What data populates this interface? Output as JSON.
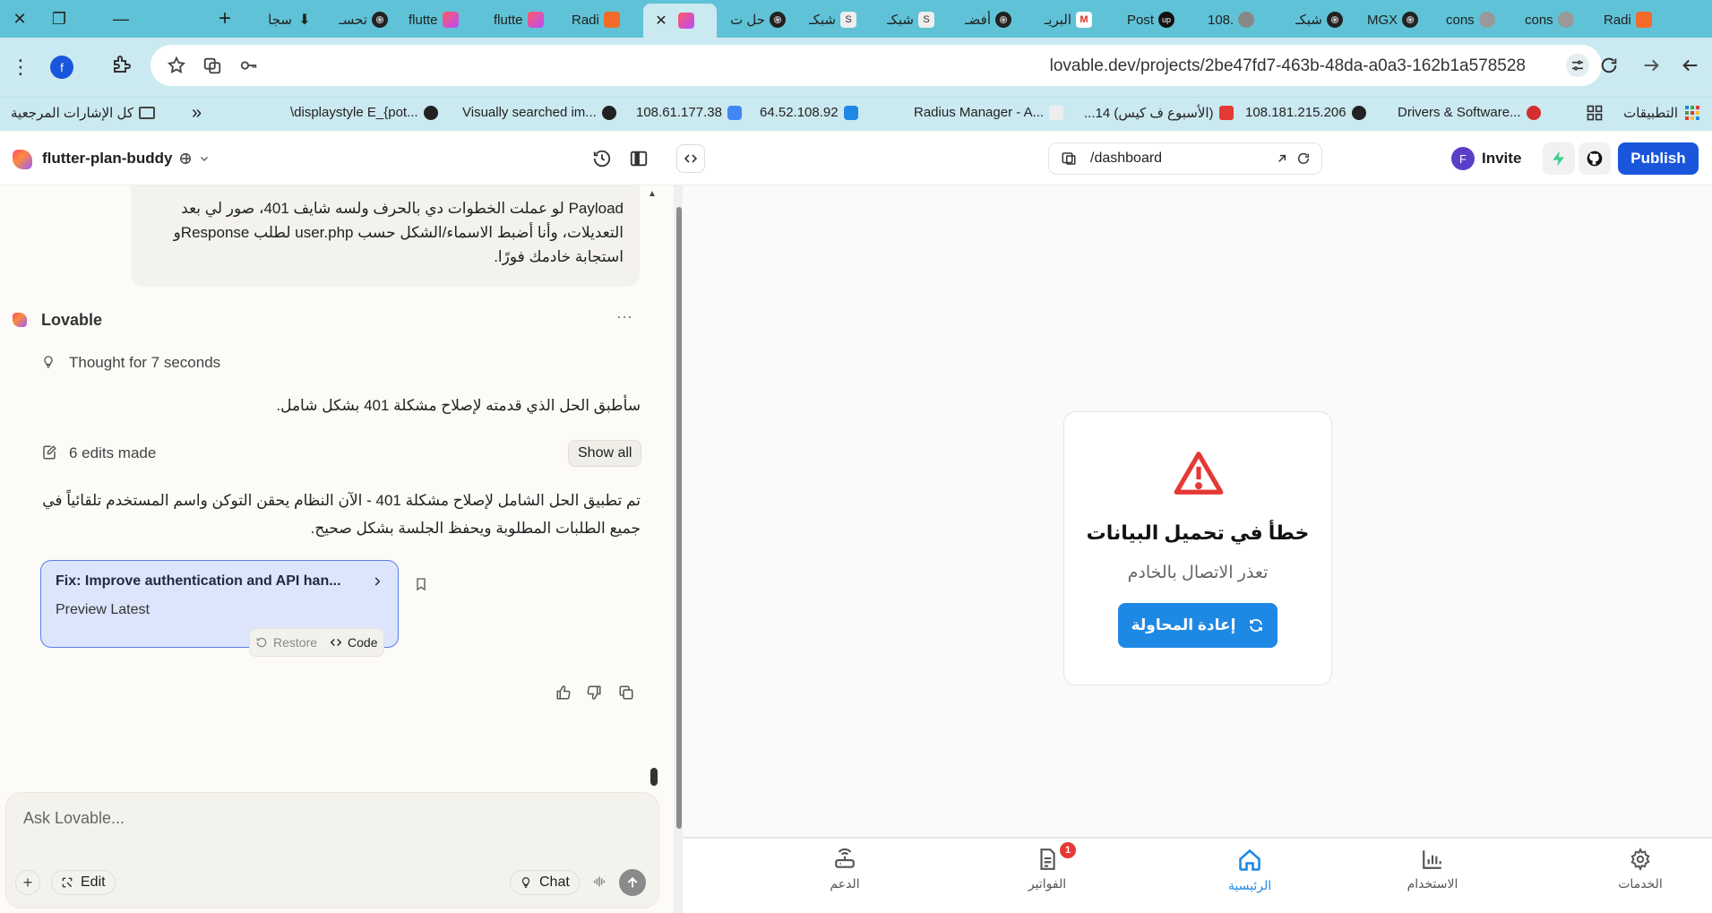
{
  "browser": {
    "window_controls": {
      "close": "✕",
      "restore": "❐",
      "minimize": "—",
      "new_tab": "+"
    },
    "tabs": [
      {
        "label": "سجا",
        "icon": "download-icon"
      },
      {
        "label": "تحسـ",
        "icon": "openai-icon"
      },
      {
        "label": "flutte",
        "icon": "lovable-icon"
      },
      {
        "label": "flutte",
        "icon": "lovable-icon"
      },
      {
        "label": "Radi",
        "icon": "radius-icon"
      },
      {
        "label": "",
        "icon": "lovable-icon",
        "active": true
      },
      {
        "label": "حل ت",
        "icon": "openai-icon"
      },
      {
        "label": "شبكـ",
        "icon": "s-icon"
      },
      {
        "label": "شبكـ",
        "icon": "s-icon"
      },
      {
        "label": "أفضـ",
        "icon": "openai-icon"
      },
      {
        "label": "البريـ",
        "icon": "gmail-icon"
      },
      {
        "label": "Post",
        "icon": "up-icon"
      },
      {
        "label": "108.",
        "icon": "globe-icon"
      },
      {
        "label": "شبكـ",
        "icon": "openai-icon"
      },
      {
        "label": "MGX",
        "icon": "openai-icon"
      },
      {
        "label": "cons",
        "icon": "globe-icon"
      },
      {
        "label": "cons",
        "icon": "globe-icon"
      },
      {
        "label": "Radi",
        "icon": "radius-icon"
      }
    ],
    "url": "lovable.dev/projects/2be47fd7-463b-48da-a0a3-162b1a578528",
    "profile_initial": "f",
    "bookmarks": [
      {
        "label": "التطبيقات",
        "icon": "apps-grid-icon"
      },
      {
        "label": "Drivers & Software...",
        "icon": "t-icon"
      },
      {
        "label": "108.181.215.206",
        "icon": "globe-icon"
      },
      {
        "label": "(الأسبوع ف كيس) 14...",
        "icon": "youtube-icon"
      },
      {
        "label": "Radius Manager - A...",
        "icon": "s-icon"
      },
      {
        "label": "64.52.108.92",
        "icon": "wifi-icon"
      },
      {
        "label": "108.61.177.38",
        "icon": "globe-icon"
      },
      {
        "label": "Visually searched im...",
        "icon": "globe-icon"
      },
      {
        "label": "\\displaystyle E_{pot...",
        "icon": "globe-icon"
      },
      {
        "label": "كل الإشارات المرجعية",
        "icon": "folder-icon"
      }
    ]
  },
  "header": {
    "project_name": "flutter-plan-buddy",
    "route": "/dashboard",
    "invite_label": "Invite",
    "invite_avatar": "F",
    "publish_label": "Publish"
  },
  "chat": {
    "user_message": "Payload لو عملت الخطوات دي بالحرف ولسه شايف 401، صور لي بعد التعديلات، وأنا أضبط الاسماء/الشكل حسب user.php لطلب Responseو استجابة خادمك فورًا.",
    "assistant_name": "Lovable",
    "more_label": "···",
    "thought_label": "Thought for 7 seconds",
    "intro_text": "سأطبق الحل الذي قدمته لإصلاح مشكلة 401 بشكل شامل.",
    "edits_label": "6 edits made",
    "show_all_label": "Show all",
    "summary_text": "تم تطبيق الحل الشامل لإصلاح مشكلة 401 - الآن النظام يحقن التوكن واسم المستخدم تلقائياً في جميع الطلبات المطلوبة ويحفظ الجلسة بشكل صحيح.",
    "commit_card": {
      "title": "Fix: Improve authentication and API han...",
      "subtitle": "Preview Latest"
    },
    "restore_label": "Restore",
    "code_label": "Code",
    "composer_placeholder": "Ask Lovable...",
    "edit_label": "Edit",
    "chat_label": "Chat"
  },
  "preview": {
    "error_title": "خطأ في تحميل البيانات",
    "error_subtitle": "تعذر الاتصال بالخادم",
    "retry_label": "إعادة المحاولة",
    "nav": [
      {
        "label": "الخدمات",
        "icon": "gear-icon"
      },
      {
        "label": "الاستخدام",
        "icon": "bar-chart-icon"
      },
      {
        "label": "الرئيسية",
        "icon": "home-icon",
        "active": true
      },
      {
        "label": "الفواتير",
        "icon": "invoice-icon",
        "badge": "1"
      },
      {
        "label": "الدعم",
        "icon": "router-icon"
      }
    ]
  },
  "colors": {
    "tabbar": "#60c2d6",
    "toolbar": "#cbe9f0",
    "publish": "#1a56db",
    "accent_blue": "#1e88e5",
    "error_red": "#e53935",
    "commit_card_bg": "#dce5fb"
  }
}
